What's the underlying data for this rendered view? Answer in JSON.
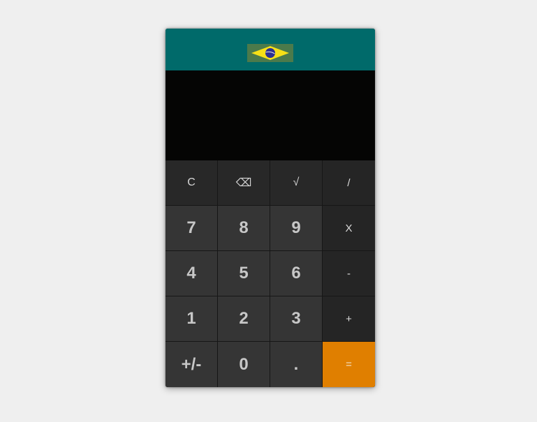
{
  "header": {
    "flag_icon": "brazil-flag-icon",
    "colors": {
      "header_bg": "#006a6a",
      "flag_green": "#4c7a4b",
      "flag_yellow": "#f7e017",
      "flag_blue": "#2e3192"
    }
  },
  "display": {
    "value": ""
  },
  "keys": {
    "clear": "C",
    "backspace": "⌫",
    "sqrt": "√",
    "divide": "/",
    "seven": "7",
    "eight": "8",
    "nine": "9",
    "multiply": "X",
    "four": "4",
    "five": "5",
    "six": "6",
    "subtract": "-",
    "one": "1",
    "two": "2",
    "three": "3",
    "add": "+",
    "negate": "+/-",
    "zero": "0",
    "decimal": ".",
    "equals": "="
  },
  "colors": {
    "page_bg": "#efefef",
    "display_bg": "#050504",
    "number_key_bg": "#353535",
    "function_key_bg": "#282828",
    "equals_bg": "#e07f00"
  }
}
